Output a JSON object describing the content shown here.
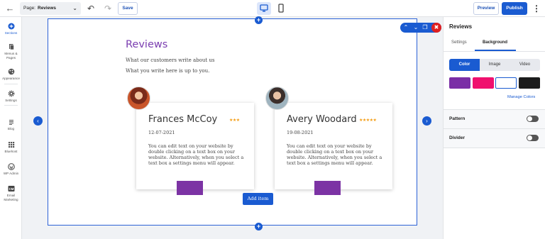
{
  "topbar": {
    "page_prefix": "Page:",
    "page_name": "Reviews",
    "save_label": "Save",
    "preview_label": "Preview",
    "publish_label": "Publish"
  },
  "sidebar": {
    "items": [
      {
        "label": "Sections",
        "icon": "plus-circle-icon"
      },
      {
        "label": "Menus & Pages",
        "icon": "pages-icon"
      },
      {
        "label": "Appearance",
        "icon": "palette-icon"
      },
      {
        "label": "Settings",
        "icon": "gear-icon"
      },
      {
        "label": "Blog",
        "icon": "blog-icon"
      },
      {
        "label": "Bluehost",
        "icon": "grid-icon"
      },
      {
        "label": "WP Admin",
        "icon": "wordpress-icon"
      },
      {
        "label": "Email Marketing",
        "icon": "cm-icon"
      }
    ]
  },
  "section": {
    "heading": "Reviews",
    "subtitle": "What our customers write about us",
    "subtitle2": "What you write here is up to you.",
    "add_item_label": "Add item",
    "reviews": [
      {
        "name": "Frances McCoy",
        "stars": "★★★",
        "date": "12-07-2021",
        "text": "You can edit text on your website by double clicking on a text box on your website. Alternatively, when you select a text box a settings menu will appear."
      },
      {
        "name": "Avery Woodard",
        "stars": "★★★★★",
        "date": "19-08-2021",
        "text": "You can edit text on your website by double clicking on a text box on your website. Alternatively, when you select a text box a settings menu will appear."
      }
    ]
  },
  "panel": {
    "title": "Reviews",
    "tabs": [
      "Settings",
      "Background"
    ],
    "active_tab": "Background",
    "bg_types": [
      "Color",
      "Image",
      "Video"
    ],
    "active_bg_type": "Color",
    "swatches": [
      "#7a2ea6",
      "#f0106e",
      "#ffffff",
      "#1c1c1c"
    ],
    "manage_colors_label": "Manage Colors",
    "pattern_label": "Pattern",
    "divider_label": "Divider"
  },
  "colors": {
    "accent": "#1a5bd1",
    "heading": "#7a3db0",
    "card_block": "#7c33a4"
  }
}
